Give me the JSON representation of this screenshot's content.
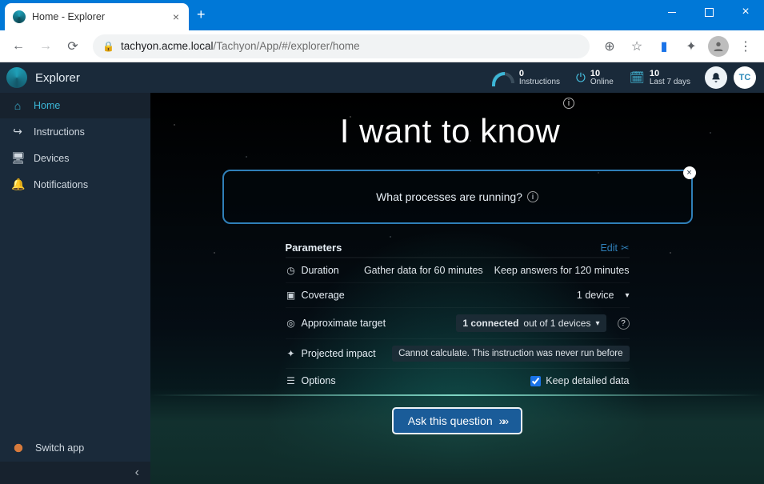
{
  "browser": {
    "tab_title": "Home - Explorer",
    "url_domain": "tachyon.acme.local",
    "url_path": "/Tachyon/App/#/explorer/home"
  },
  "header": {
    "app_name": "Explorer",
    "stats": {
      "instructions": {
        "value": "0",
        "label": "Instructions"
      },
      "online": {
        "value": "10",
        "label": "Online"
      },
      "period": {
        "value": "10",
        "label": "Last 7 days"
      }
    },
    "user_initials": "TC"
  },
  "sidebar": {
    "items": [
      {
        "label": "Home"
      },
      {
        "label": "Instructions"
      },
      {
        "label": "Devices"
      },
      {
        "label": "Notifications"
      }
    ],
    "switch_label": "Switch app"
  },
  "main": {
    "hero": "I want to know",
    "question": "What processes are running?",
    "params": {
      "title": "Parameters",
      "edit": "Edit",
      "duration": {
        "label": "Duration",
        "gather": "Gather data for 60 minutes",
        "keep": "Keep answers for 120 minutes"
      },
      "coverage": {
        "label": "Coverage",
        "value": "1 device"
      },
      "target": {
        "label": "Approximate target",
        "value_prefix": "1 connected",
        "value_suffix": " out of 1 devices"
      },
      "impact": {
        "label": "Projected impact",
        "value": "Cannot calculate. This instruction was never run before"
      },
      "options": {
        "label": "Options",
        "checkbox": "Keep detailed data"
      }
    },
    "ask_button": "Ask this question"
  }
}
